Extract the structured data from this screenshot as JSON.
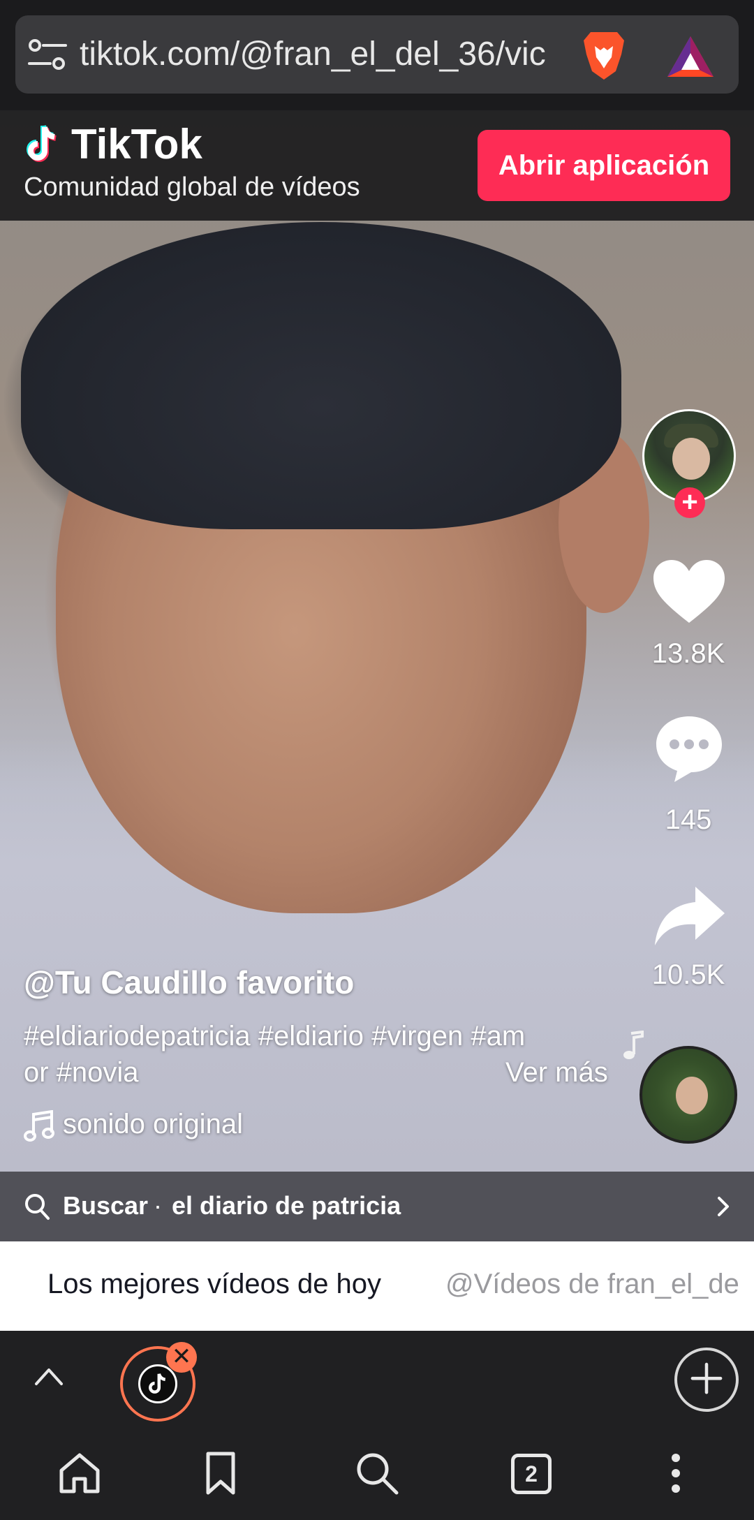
{
  "browser": {
    "url": "tiktok.com/@fran_el_del_36/vic"
  },
  "tiktok_header": {
    "logo_text": "TikTok",
    "tagline": "Comunidad global de vídeos",
    "open_app_label": "Abrir aplicación"
  },
  "actions": {
    "likes": "13.8K",
    "comments": "145",
    "shares": "10.5K"
  },
  "post": {
    "author": "@Tu Caudillo favorito",
    "caption_line1": "#eldiariodepatricia #eldiario #virgen #am",
    "caption_line2": "or #novia",
    "see_more": "Ver más",
    "sound": "sonido original"
  },
  "search": {
    "label": "Buscar",
    "separator": "·",
    "query": "el diario de patricia"
  },
  "strip_tabs": [
    "Los mejores vídeos de hoy",
    "@Vídeos de fran_el_de"
  ],
  "tabs": {
    "open_tab_count": "2"
  },
  "colors": {
    "tiktok_red": "#fe2c55",
    "tab_accent": "#ff7550"
  },
  "icons": {
    "url_settings": "sliders-icon",
    "brave": "brave-lion-icon",
    "bat": "bat-triangle-icon",
    "like": "heart-icon",
    "comment": "chat-bubble-icon",
    "share": "share-arrow-icon",
    "sound": "music-note-icon",
    "search": "search-icon",
    "home": "home-icon",
    "bookmark": "bookmark-icon",
    "menu": "kebab-menu-icon"
  }
}
